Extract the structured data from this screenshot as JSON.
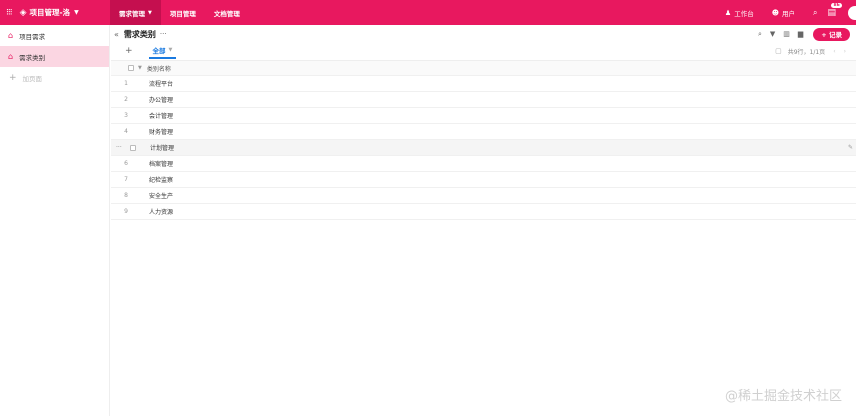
{
  "topbar": {
    "brand": "项目管理-洛",
    "nav": [
      {
        "label": "需求管理",
        "active": true
      },
      {
        "label": "项目管理",
        "active": false
      },
      {
        "label": "文档管理",
        "active": false
      }
    ],
    "workspace": "工作台",
    "users": "用户",
    "badge": "86",
    "accent": "#e8185f"
  },
  "sidebar": {
    "items": [
      {
        "label": "项目需求",
        "icon": "home-icon",
        "active": false
      },
      {
        "label": "需求类别",
        "icon": "home-icon",
        "active": true
      }
    ],
    "add_label": "加页面"
  },
  "main": {
    "title": "需求类别",
    "add_button": "+ 记录",
    "view_tab": "全部",
    "stats": "共9行，1/1页",
    "column_header": "类别名称",
    "rows": [
      {
        "index": "1",
        "name": "流程平台"
      },
      {
        "index": "2",
        "name": "办公管理"
      },
      {
        "index": "3",
        "name": "会计管理"
      },
      {
        "index": "4",
        "name": "财务管理"
      },
      {
        "index": "",
        "name": "计划管理"
      },
      {
        "index": "6",
        "name": "档案管理"
      },
      {
        "index": "7",
        "name": "纪检监察"
      },
      {
        "index": "8",
        "name": "安全生产"
      },
      {
        "index": "9",
        "name": "人力资源"
      }
    ]
  },
  "watermark": "@稀土掘金技术社区"
}
